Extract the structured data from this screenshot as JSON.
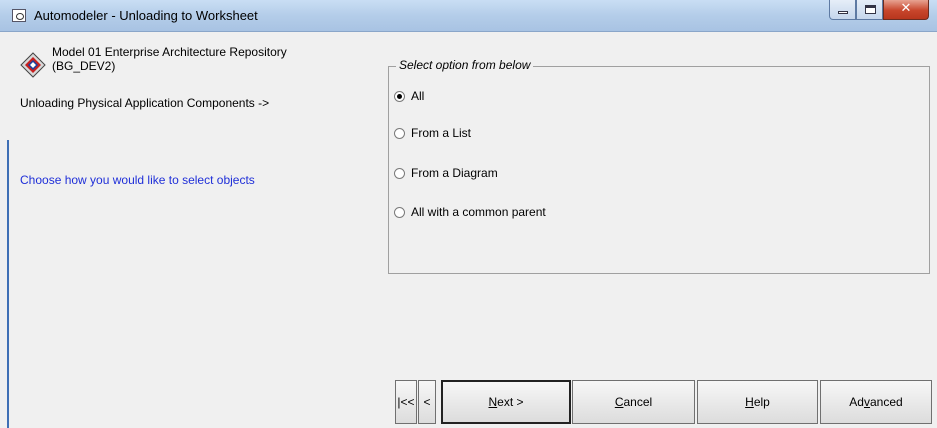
{
  "window": {
    "title": "Automodeler - Unloading to Worksheet"
  },
  "info": {
    "model_line1": "Model 01 Enterprise Architecture Repository",
    "model_line2": "(BG_DEV2)",
    "unloading": "Unloading Physical Application Components ->",
    "prompt": "Choose how you would like to select objects",
    "prompt_color": "#1f2fd8"
  },
  "options": {
    "legend": "Select option from below",
    "items": [
      {
        "label": "All",
        "checked": true
      },
      {
        "label": "From a List",
        "checked": false
      },
      {
        "label": "From a Diagram",
        "checked": false
      },
      {
        "label": "All with a common parent",
        "checked": false
      }
    ]
  },
  "buttons": {
    "first": "|<<",
    "prev": "<",
    "next_mnemonic": "N",
    "next_rest": "ext >",
    "cancel_mnemonic": "C",
    "cancel_rest": "ancel",
    "help_mnemonic": "H",
    "help_rest": "elp",
    "advanced_pre": "Ad",
    "advanced_mnemonic": "v",
    "advanced_post": "anced"
  },
  "icons": {
    "app": "automodeler-app-icon",
    "model": "model-diamond-icon",
    "minimize": "minimize-icon",
    "maximize": "maximize-icon",
    "close": "close-icon"
  }
}
